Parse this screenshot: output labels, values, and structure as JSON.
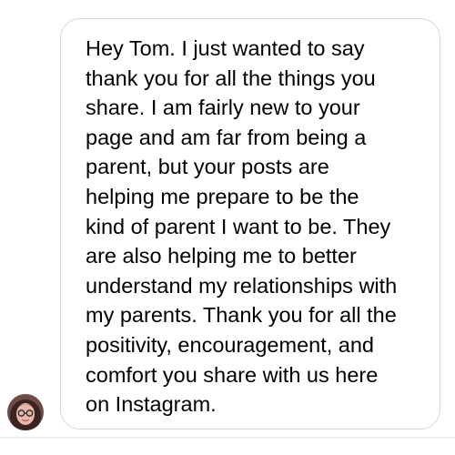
{
  "message": {
    "lines": [
      "Hey Tom. I just wanted to say",
      "thank you for all the things you",
      "share. I am fairly new to your",
      "page and am far from being a",
      "parent, but your posts are",
      "helping me prepare to be the",
      "kind of parent I want to be. They",
      "are also helping me to better",
      "understand my relationships with",
      "my parents. Thank you for all the",
      "positivity, encouragement, and",
      "comfort you share with us here",
      "on Instagram."
    ]
  },
  "sender": {
    "avatar_icon": "user-avatar-photo"
  },
  "colors": {
    "bubble_border": "#d9d9d9",
    "text": "#000000",
    "background": "#ffffff"
  }
}
